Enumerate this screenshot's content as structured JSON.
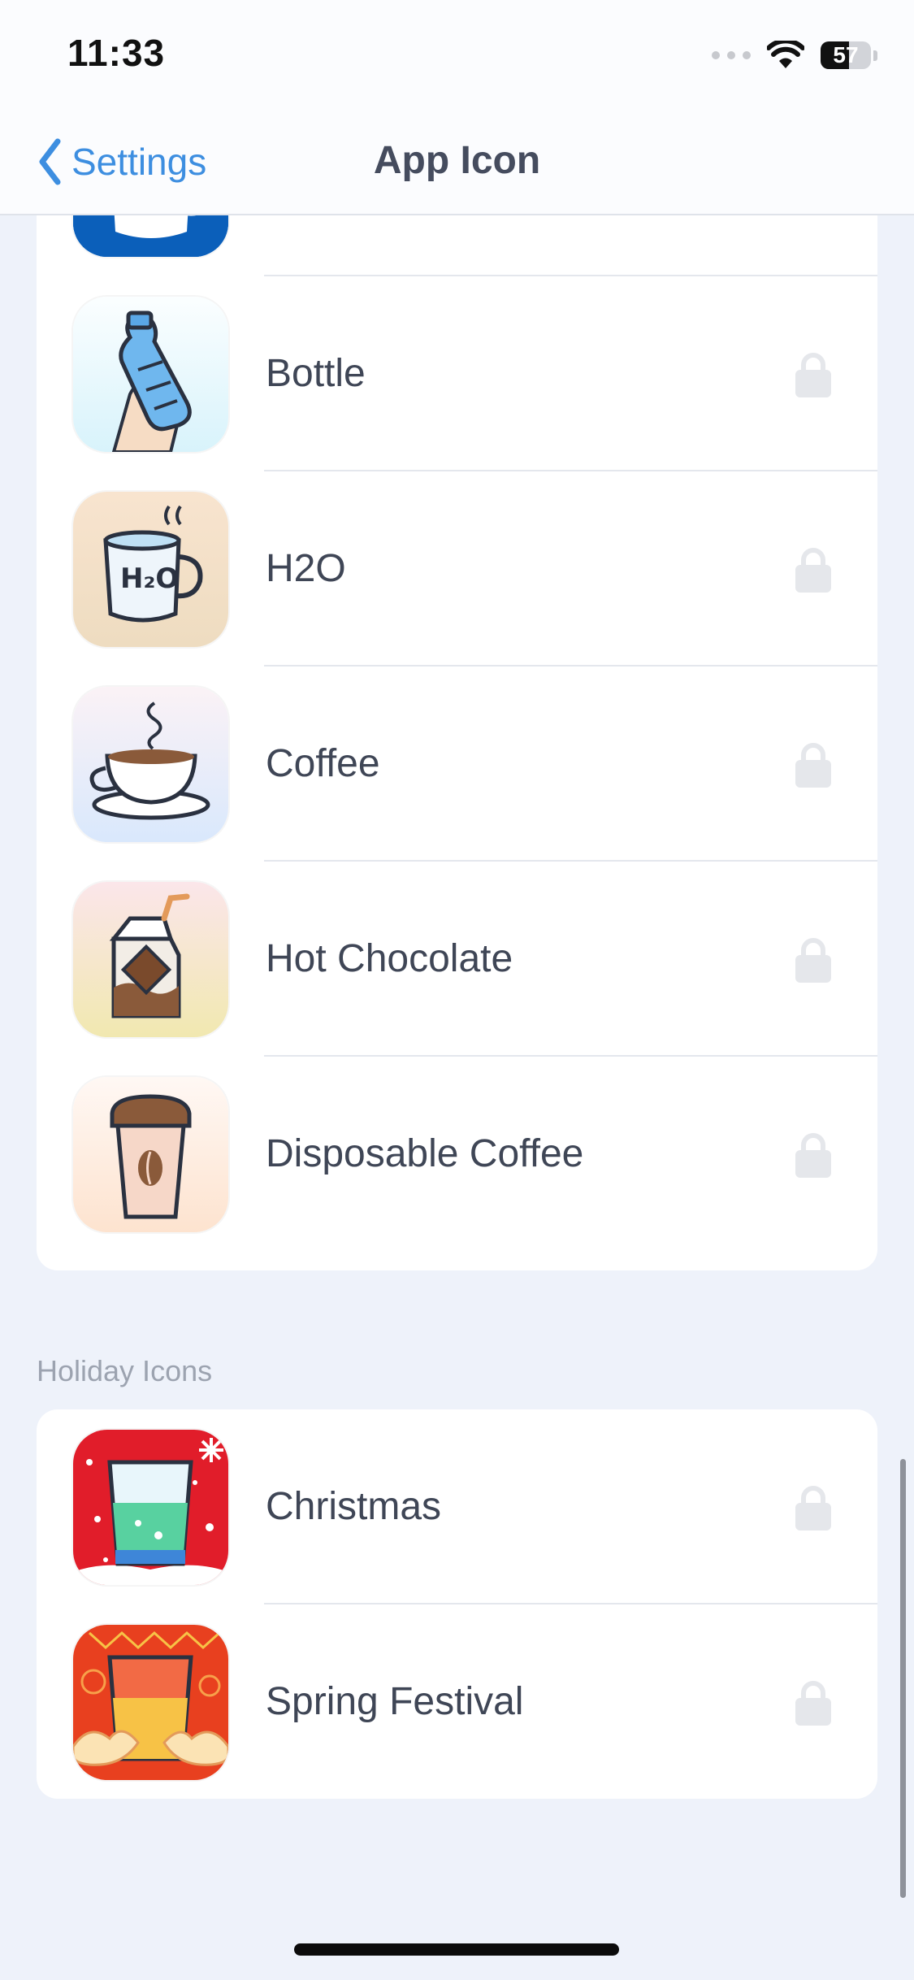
{
  "status_bar": {
    "time": "11:33",
    "battery": "57",
    "battery_level": 0.57
  },
  "nav": {
    "back_label": "Settings",
    "title": "App Icon"
  },
  "icons": [
    {
      "label": "",
      "icon": "cup-icon",
      "locked": true
    },
    {
      "label": "Bottle",
      "icon": "bottle-icon",
      "locked": true
    },
    {
      "label": "H2O",
      "icon": "h2o-mug-icon",
      "locked": true
    },
    {
      "label": "Coffee",
      "icon": "coffee-cup-icon",
      "locked": true
    },
    {
      "label": "Hot Chocolate",
      "icon": "chocolate-carton-icon",
      "locked": true
    },
    {
      "label": "Disposable Coffee",
      "icon": "takeaway-coffee-icon",
      "locked": true
    }
  ],
  "holiday": {
    "header": "Holiday Icons",
    "icons": [
      {
        "label": "Christmas",
        "icon": "christmas-glass-icon",
        "locked": true
      },
      {
        "label": "Spring Festival",
        "icon": "spring-festival-glass-icon",
        "locked": true
      }
    ]
  },
  "colors": {
    "accent": "#3d8ee0",
    "background": "#eef2fa",
    "lock": "#e5e7eb"
  }
}
